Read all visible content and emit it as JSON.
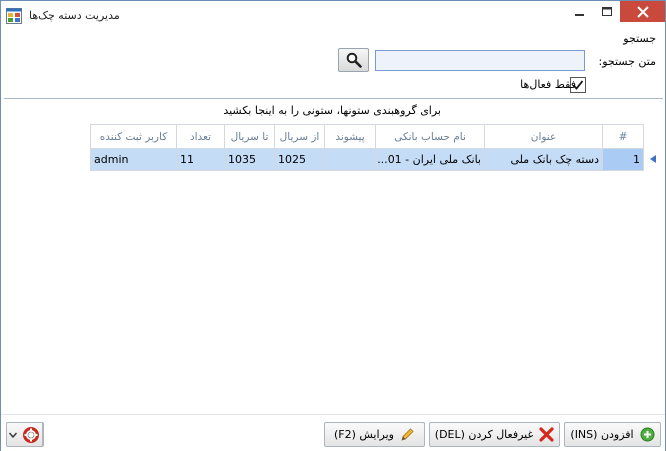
{
  "window": {
    "title": "مدیریت دسته چک‌ها"
  },
  "search": {
    "group_title": "جستجو",
    "field_label": "متن جستجو:",
    "value": "",
    "active_only_label": "فقط فعال‌ها",
    "active_only_checked": true
  },
  "grid": {
    "group_hint": "برای گروهبندی ستونها، ستونی را به اینجا بکشید",
    "columns": {
      "index": "#",
      "title": "عنوان",
      "bank_account": "نام حساب بانکی",
      "prefix": "پیشوند",
      "from_serial": "از سریال",
      "to_serial": "تا سریال",
      "count": "تعداد",
      "creator": "کاربر ثبت کننده"
    },
    "rows": [
      {
        "index": "1",
        "title": "دسته چک بانک ملی",
        "bank_account": "بانک ملی ایران - 01...",
        "prefix": "",
        "from_serial": "1025",
        "to_serial": "1035",
        "count": "11",
        "creator": "admin"
      }
    ]
  },
  "toolbar": {
    "add_label": "افزودن (INS)",
    "deactivate_label": "غیرفعال کردن (DEL)",
    "edit_label": "ویرایش (F2)"
  },
  "icons": {
    "app": "app-icon",
    "search": "magnifier-icon",
    "add": "plus-circle-icon",
    "deactivate": "red-x-icon",
    "edit": "pencil-icon",
    "help": "lifebuoy-icon"
  },
  "colors": {
    "selected_row": "#c5dcf7",
    "close_button": "#c94a3c",
    "header_text": "#6b7f99"
  }
}
